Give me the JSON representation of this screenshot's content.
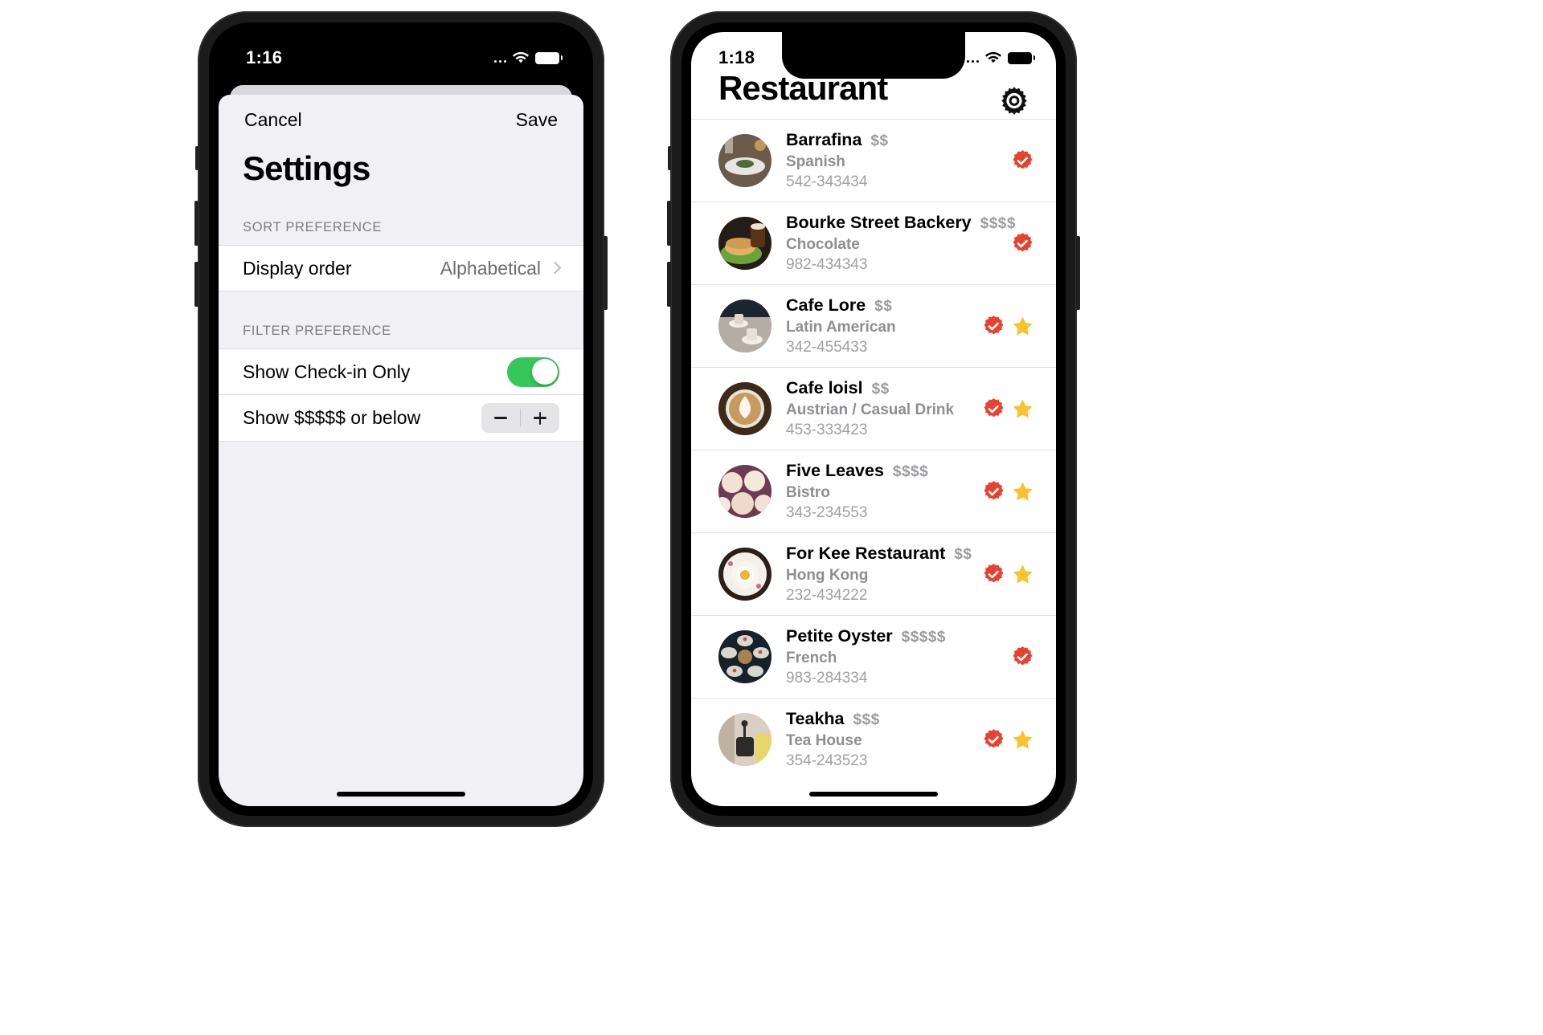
{
  "left_phone": {
    "status": {
      "time": "1:16",
      "wifi_icon": "wifi-icon",
      "battery_icon": "battery-icon",
      "signal_icon": "signal-dots-icon"
    },
    "sheet": {
      "cancel_label": "Cancel",
      "save_label": "Save",
      "title": "Settings",
      "sections": [
        {
          "header": "SORT PREFERENCE",
          "rows": [
            {
              "label": "Display order",
              "value": "Alphabetical",
              "accessory": "chevron-right-icon"
            }
          ]
        },
        {
          "header": "FILTER PREFERENCE",
          "rows": [
            {
              "label": "Show Check-in Only",
              "accessory": "toggle-on"
            },
            {
              "label": "Show $$$$$ or below",
              "accessory": "stepper",
              "minus_label": "minus-icon",
              "plus_label": "plus-icon"
            }
          ]
        }
      ]
    }
  },
  "right_phone": {
    "status": {
      "time": "1:18",
      "wifi_icon": "wifi-icon",
      "battery_icon": "battery-icon",
      "signal_icon": "signal-dots-icon"
    },
    "settings_icon": "gear-icon",
    "title": "Restaurant",
    "restaurants": [
      {
        "name": "Barrafina",
        "price": "$$",
        "type": "Spanish",
        "phone": "542-343434",
        "checked": true,
        "favorite": false,
        "img": "plated-dish"
      },
      {
        "name": "Bourke Street Backery",
        "price": "$$$$",
        "type": "Chocolate",
        "phone": "982-434343",
        "checked": true,
        "favorite": false,
        "img": "sandwich-beer"
      },
      {
        "name": "Cafe Lore",
        "price": "$$",
        "type": "Latin American",
        "phone": "342-455433",
        "checked": true,
        "favorite": true,
        "img": "coffee-counter"
      },
      {
        "name": "Cafe loisl",
        "price": "$$",
        "type": "Austrian / Casual Drink",
        "phone": "453-333423",
        "checked": true,
        "favorite": true,
        "img": "latte-art"
      },
      {
        "name": "Five Leaves",
        "price": "$$$$",
        "type": "Bistro",
        "phone": "343-234553",
        "checked": true,
        "favorite": true,
        "img": "cupcakes"
      },
      {
        "name": "For Kee Restaurant",
        "price": "$$",
        "type": "Hong Kong",
        "phone": "232-434222",
        "checked": true,
        "favorite": true,
        "img": "egg-toast"
      },
      {
        "name": "Petite Oyster",
        "price": "$$$$$",
        "type": "French",
        "phone": "983-284334",
        "checked": true,
        "favorite": false,
        "img": "oysters"
      },
      {
        "name": "Teakha",
        "price": "$$$",
        "type": "Tea House",
        "phone": "354-243523",
        "checked": true,
        "favorite": true,
        "img": "teapot"
      }
    ]
  },
  "colors": {
    "toggle_on": "#34c759",
    "seal_red": "#e8412f",
    "star_yellow": "#f6c game",
    "star": "#f9c22e",
    "sheet_bg": "#f1f1f5",
    "cell_bg": "#ffffff",
    "secondary_text": "#8e8e93"
  }
}
